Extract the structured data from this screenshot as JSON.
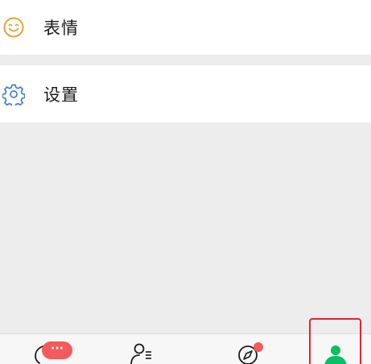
{
  "menu": {
    "emoji": {
      "label": "表情",
      "icon": "smiley-icon"
    },
    "settings": {
      "label": "设置",
      "icon": "gear-icon"
    }
  },
  "tabbar": {
    "chats": {
      "icon": "chat-bubble-icon",
      "badge": "···"
    },
    "contacts": {
      "icon": "contacts-icon"
    },
    "discover": {
      "icon": "compass-icon",
      "has_dot": true
    },
    "me": {
      "icon": "person-icon",
      "active": true
    }
  },
  "colors": {
    "background": "#ededed",
    "row": "#ffffff",
    "emoji_icon": "#e0a43a",
    "settings_icon": "#3d7fd9",
    "badge": "#f15b5b",
    "active_tab": "#07c160",
    "highlight": "#e0243a"
  }
}
